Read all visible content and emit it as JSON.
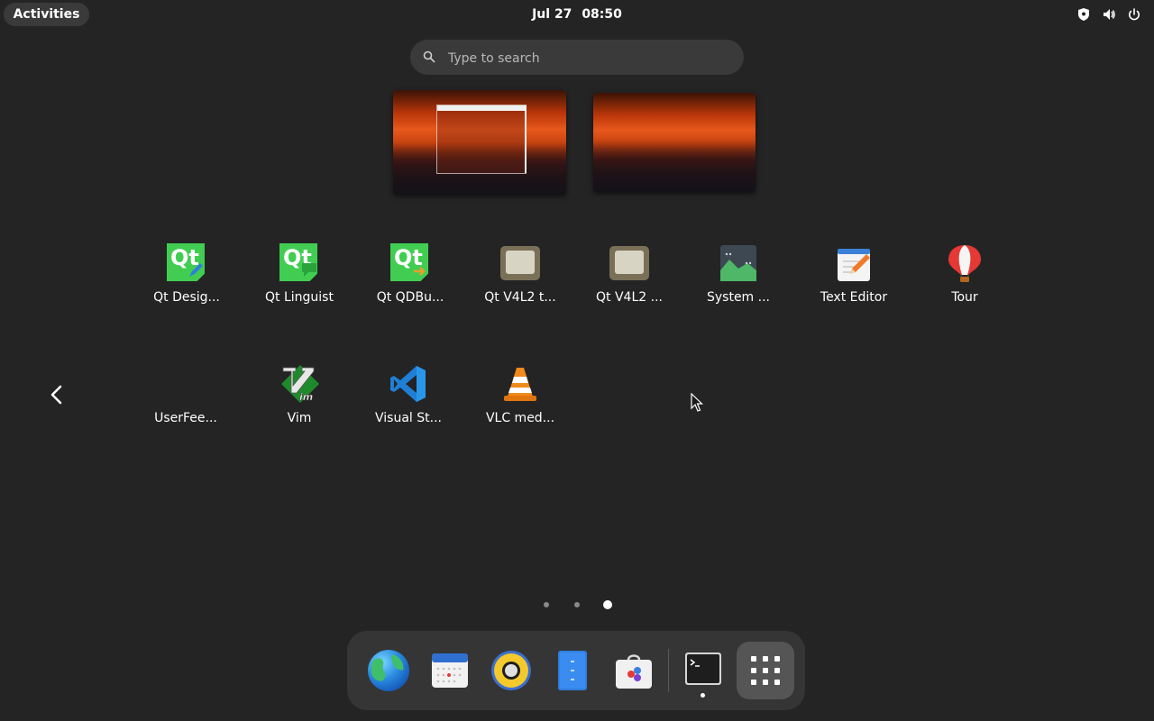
{
  "topbar": {
    "activities_label": "Activities",
    "date": "Jul 27",
    "time": "08:50",
    "status_icons": [
      "shield-icon",
      "volume-icon",
      "power-icon"
    ]
  },
  "search": {
    "placeholder": "Type to search"
  },
  "workspaces": [
    {
      "name": "workspace-1",
      "has_window": true
    },
    {
      "name": "workspace-2",
      "has_window": false
    }
  ],
  "app_grid": {
    "page": 3,
    "total_pages": 3,
    "apps": [
      {
        "label": "Qt Desig...",
        "icon": "qt-designer-icon"
      },
      {
        "label": "Qt Linguist",
        "icon": "qt-linguist-icon"
      },
      {
        "label": "Qt QDBu...",
        "icon": "qt-qdbusviewer-icon"
      },
      {
        "label": "Qt V4L2 t...",
        "icon": "qt-v4l2-test-icon"
      },
      {
        "label": "Qt V4L2 ...",
        "icon": "qt-v4l2-icon"
      },
      {
        "label": "System ...",
        "icon": "system-monitor-icon"
      },
      {
        "label": "Text Editor",
        "icon": "text-editor-icon"
      },
      {
        "label": "Tour",
        "icon": "tour-balloon-icon"
      },
      {
        "label": "UserFee...",
        "icon": "user-feedback-icon"
      },
      {
        "label": "Vim",
        "icon": "vim-icon"
      },
      {
        "label": "Visual St...",
        "icon": "vscode-icon"
      },
      {
        "label": "VLC med...",
        "icon": "vlc-icon"
      }
    ]
  },
  "dock": {
    "items": [
      {
        "name": "web-browser",
        "icon": "globe-icon"
      },
      {
        "name": "calendar",
        "icon": "calendar-icon"
      },
      {
        "name": "music",
        "icon": "speaker-icon"
      },
      {
        "name": "files",
        "icon": "file-cabinet-icon"
      },
      {
        "name": "software",
        "icon": "software-bag-icon"
      },
      {
        "name": "terminal",
        "icon": "terminal-icon",
        "running": true
      },
      {
        "name": "show-apps",
        "icon": "app-grid-icon"
      }
    ]
  },
  "colors": {
    "background": "#242424",
    "panel": "#3a3a3a",
    "dock": "#353535",
    "qt_green": "#41cd52"
  }
}
